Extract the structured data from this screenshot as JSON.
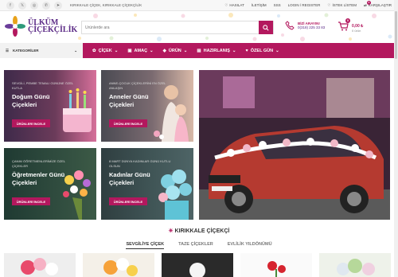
{
  "topbar": {
    "social_icons": [
      "facebook-icon",
      "x-icon",
      "instagram-icon",
      "whatsapp-icon",
      "telegram-icon"
    ],
    "tagline": "KIRIKKALE ÇİÇEK, KIRIKKALE ÇİÇEKÇİLİK",
    "links": [
      "HASILAT",
      "İLETİŞİM",
      "SSS",
      "LOGIN / REGISTER",
      "İSTEK LİSTEM",
      "KARŞILAŞTIR"
    ],
    "compare_count": "0"
  },
  "header": {
    "logo_line1": "ÜLKÜM",
    "logo_line2": "ÇİÇEKÇİLİK",
    "search_placeholder": "Ürünlerde ara",
    "phone_title": "BİZİ ARAYIN!",
    "phone_number": "0(318) 225 33 83",
    "cart_amount": "0,00 ₺",
    "cart_sub": "0 ürün",
    "cart_count": "0"
  },
  "nav": {
    "categories_label": "KATEGORİLER",
    "items": [
      "ÇİÇEK",
      "AMAÇ",
      "ÜRÜN",
      "HAZIRLANIŞ",
      "ÖZEL GÜN"
    ]
  },
  "tiles": [
    {
      "tag": "SEVGİLİ, PEMBE TEMALI GÜNÜNE ÖZEL KUTLA",
      "title": "Doğum Günü Çiçekleri",
      "button": "ÜRÜNLERİ İNCELE"
    },
    {
      "tag": "ANNE-ÇOCUK ÇİÇEKLERİNİ EN ÖZEL ANLAŞIN",
      "title": "Anneler Günü Çiçekleri",
      "button": "ÜRÜNLERİ İNCELE"
    },
    {
      "tag": "ÇANIM ÖĞRETMENLERİMİZE ÖZEL ÇİÇEKLER",
      "title": "Öğretmenler Günü Çiçekleri",
      "button": "ÜRÜNLERİ İNCELE"
    },
    {
      "tag": "8 MART DÜNYA KADINLAR GÜNÜ KUTLU OLSUN",
      "title": "Kadınlar Günü Çiçekleri",
      "button": "ÜRÜNLERİ İNCELE"
    }
  ],
  "section": {
    "title": "KIRIKKALE ÇİÇEKÇİ",
    "tabs": [
      "SEVGİLİYE ÇİÇEK",
      "TAZE ÇİÇEKLER",
      "EVLİLİK YILDÖNÜMÜ"
    ]
  },
  "colors": {
    "brand": "#b3185e",
    "purple": "#5b2a86"
  }
}
